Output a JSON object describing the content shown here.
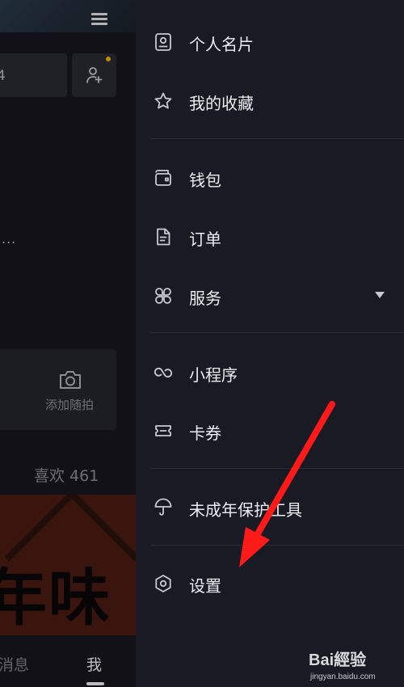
{
  "background_page": {
    "truncated_box_text": "4",
    "ellipsis": "...",
    "photo_card_label": "添加随拍",
    "likes_label": "喜欢 461",
    "banner_text": "年味",
    "tabs": [
      {
        "label": "消息"
      },
      {
        "label": "我"
      }
    ]
  },
  "drawer": {
    "items": [
      {
        "label": "个人名片",
        "icon": "contact-card-icon"
      },
      {
        "label": "我的收藏",
        "icon": "star-icon"
      },
      {
        "label": "钱包",
        "icon": "wallet-icon"
      },
      {
        "label": "订单",
        "icon": "order-document-icon"
      },
      {
        "label": "服务",
        "icon": "services-grid-icon",
        "expandable": true
      },
      {
        "label": "小程序",
        "icon": "mini-program-icon"
      },
      {
        "label": "卡券",
        "icon": "ticket-icon"
      },
      {
        "label": "未成年保护工具",
        "icon": "umbrella-icon"
      },
      {
        "label": "设置",
        "icon": "gear-icon"
      }
    ]
  },
  "annotation": {
    "arrow_color": "#ff1a1a",
    "points_to": "设置"
  },
  "watermark": {
    "main": "Bai經验",
    "sub": "jingyan.baidu.com"
  },
  "colors": {
    "drawer_bg": "#1a1a24",
    "text": "#ececf1",
    "icon": "#c9c9d2",
    "badge": "#f2b705"
  }
}
